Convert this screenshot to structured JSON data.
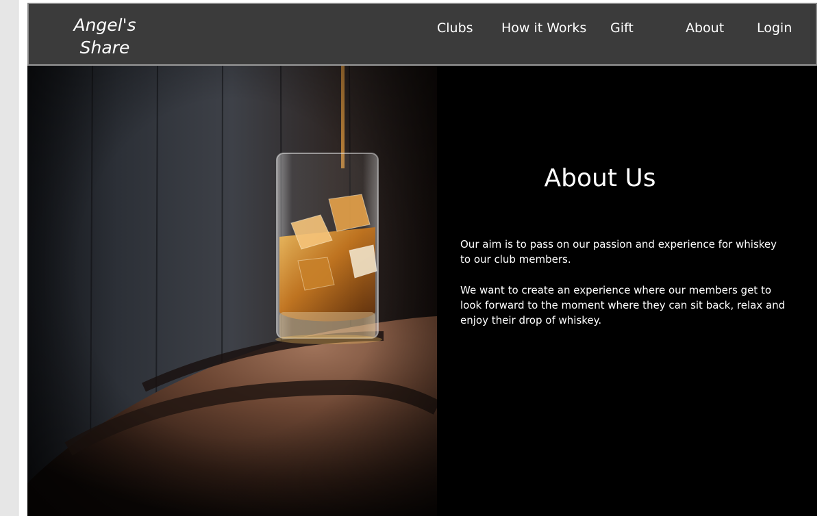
{
  "brand": {
    "line1": "Angel's",
    "line2": "Share"
  },
  "nav": {
    "clubs": "Clubs",
    "how_it_works": "How it Works",
    "gift": "Gift",
    "about": "About",
    "login": "Login"
  },
  "about_section": {
    "title": "About Us",
    "paragraph1": "Our aim is to pass on our passion and experience for whiskey to our club members.",
    "paragraph2": "We want to create an experience where our members get to look forward to the moment where they can sit back, relax and enjoy their drop of whiskey."
  },
  "hero_image": {
    "subject": "whiskey-glass-on-barrel"
  },
  "colors": {
    "navbar_bg": "#3b3b3b",
    "page_bg": "#000000",
    "text": "#ffffff"
  }
}
